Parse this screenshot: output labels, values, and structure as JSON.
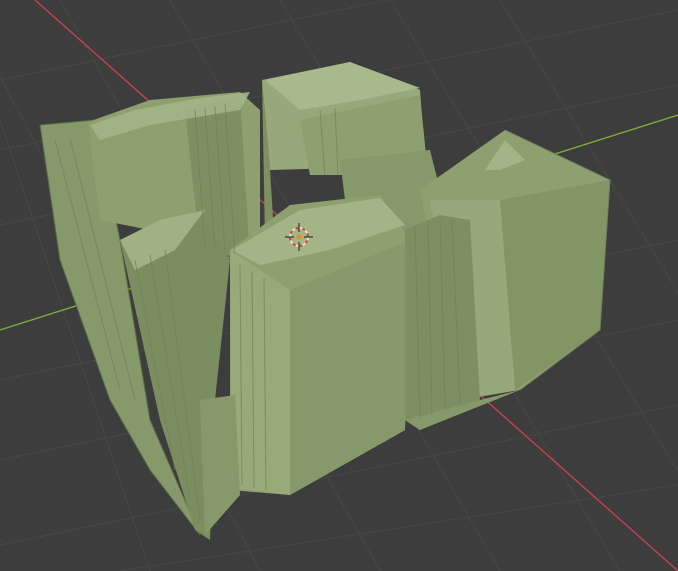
{
  "viewport": {
    "background": "#3d3d3d",
    "grid_color": "#474747",
    "x_axis_color": "#c8424f",
    "y_axis_color": "#7fae3a"
  },
  "object": {
    "face_light": "#97a97a",
    "face_mid": "#86996a",
    "face_dark": "#6f8257",
    "edge_dark": "#5b6c46"
  },
  "gizmo": {
    "icon": "3d-cursor-icon",
    "ring_color": "#e8e0d0",
    "ring_accent": "#d04a2a"
  }
}
